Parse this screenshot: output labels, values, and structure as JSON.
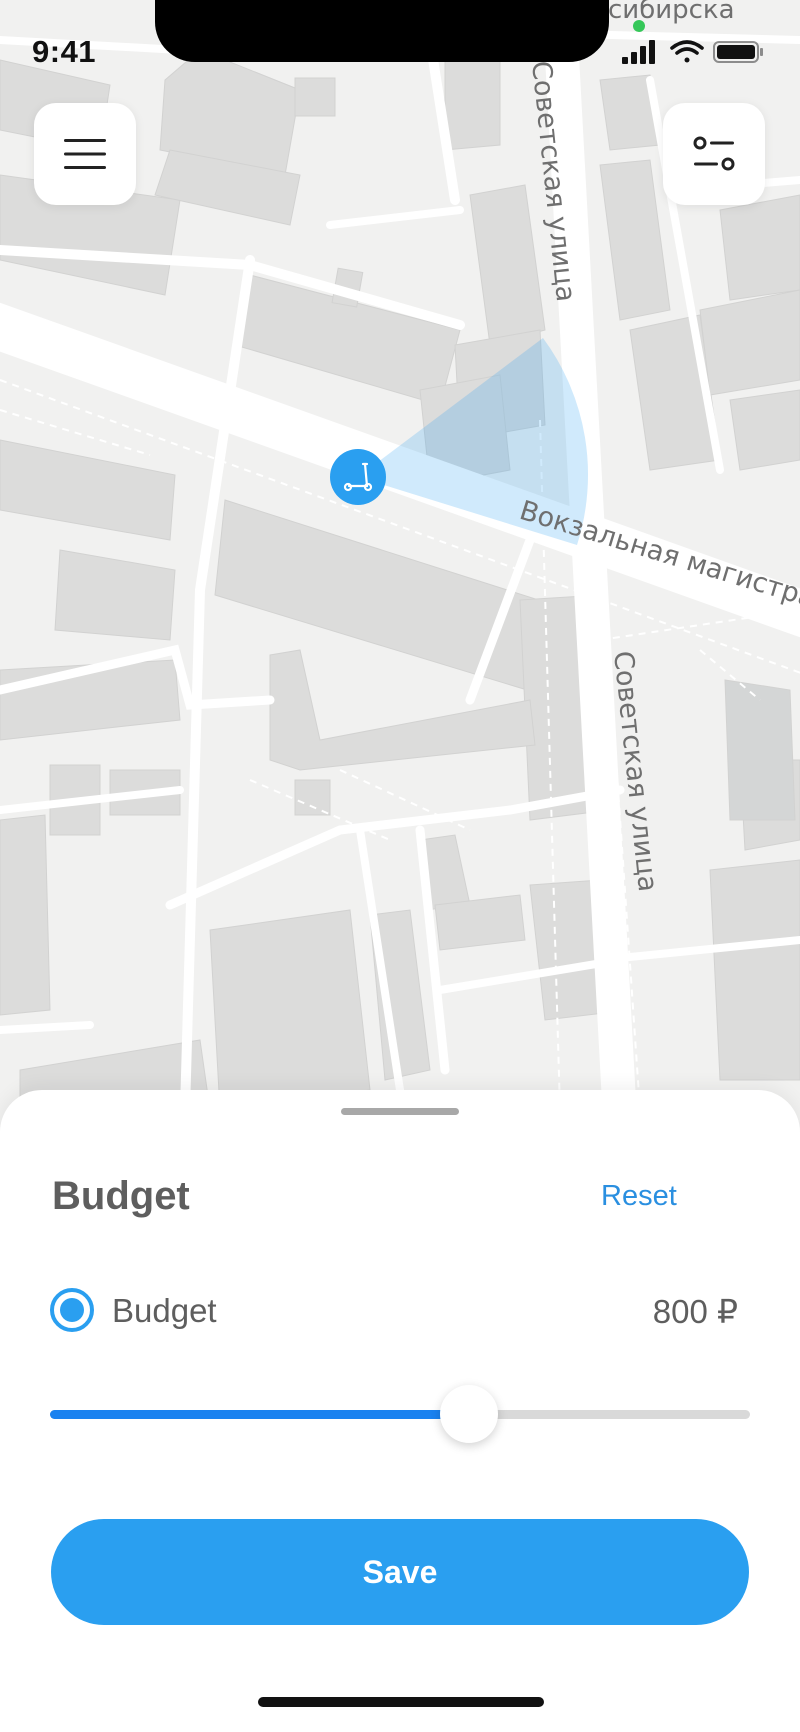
{
  "status_bar": {
    "time": "9:41"
  },
  "map": {
    "streets": {
      "top_partial": "сибирска",
      "sovetskaya_upper": "Советская улица",
      "vokzalnaya": "Вокзальная магистраль",
      "sovetskaya_lower": "Советская улица"
    },
    "menu_icon": "hamburger-icon",
    "filter_icon": "filter-toggle-icon",
    "pin_icon": "scooter-icon",
    "accent_color": "#2a9ff0"
  },
  "sheet": {
    "title": "Budget",
    "reset_label": "Reset",
    "option": {
      "label": "Budget",
      "value": "800 ₽",
      "selected": true
    },
    "slider": {
      "fraction": 0.598
    },
    "save_label": "Save"
  }
}
